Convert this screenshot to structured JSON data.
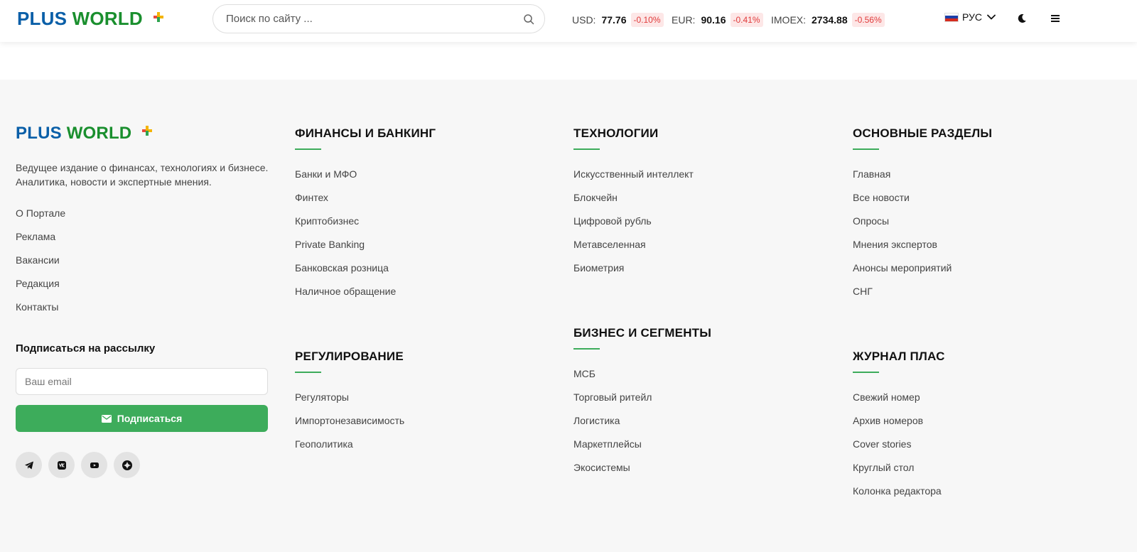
{
  "brand": {
    "part1": "PLUS",
    "part2": "WORLD"
  },
  "search": {
    "placeholder": "Поиск по сайту ..."
  },
  "tickers": [
    {
      "label": "USD:",
      "value": "77.76",
      "change": "-0.10%"
    },
    {
      "label": "EUR:",
      "value": "90.16",
      "change": "-0.41%"
    },
    {
      "label": "IMOEX:",
      "value": "2734.88",
      "change": "-0.56%"
    }
  ],
  "language": {
    "label": "РУС"
  },
  "footer": {
    "tagline_line1": "Ведущее издание о финансах, технологиях и бизнесе.",
    "tagline_line2": "Аналитика, новости и экспертные мнения.",
    "about_links": [
      "О Портале",
      "Реклама",
      "Вакансии",
      "Редакция",
      "Контакты"
    ],
    "newsletter": {
      "title": "Подписаться на рассылку",
      "email_placeholder": "Ваш email",
      "button_label": "Подписаться"
    },
    "columns": {
      "finance": {
        "title": "ФИНАНСЫ И БАНКИНГ",
        "items": [
          "Банки и МФО",
          "Финтех",
          "Криптобизнес",
          "Private Banking",
          "Банковская розница",
          "Наличное обращение"
        ]
      },
      "regulation": {
        "title": "РЕГУЛИРОВАНИЕ",
        "items": [
          "Регуляторы",
          "Импортонезависимость",
          "Геополитика"
        ]
      },
      "tech": {
        "title": "ТЕХНОЛОГИИ",
        "items": [
          "Искусственный интеллект",
          "Блокчейн",
          "Цифровой рубль",
          "Метавселенная",
          "Биометрия"
        ]
      },
      "business": {
        "title": "БИЗНЕС И СЕГМЕНТЫ",
        "items": [
          "МСБ",
          "Торговый ритейл",
          "Логистика",
          "Маркетплейсы",
          "Экосистемы"
        ]
      },
      "main": {
        "title": "ОСНОВНЫЕ РАЗДЕЛЫ",
        "items": [
          "Главная",
          "Все новости",
          "Опросы",
          "Мнения экспертов",
          "Анонсы мероприятий",
          "СНГ"
        ]
      },
      "journal": {
        "title": "ЖУРНАЛ ПЛАС",
        "items": [
          "Свежий номер",
          "Архив номеров",
          "Cover stories",
          "Круглый стол",
          "Колонка редактора"
        ]
      }
    }
  },
  "colors": {
    "brand_blue": "#0a5fa8",
    "brand_green": "#1a8f2e",
    "accent_green": "#3dac5b",
    "negative_red": "#e03b3b"
  },
  "icons": [
    "search-icon",
    "russia-flag-icon",
    "chevron-down-icon",
    "moon-icon",
    "menu-icon",
    "envelope-icon",
    "telegram-icon",
    "vk-icon",
    "youtube-icon",
    "dzen-icon"
  ]
}
